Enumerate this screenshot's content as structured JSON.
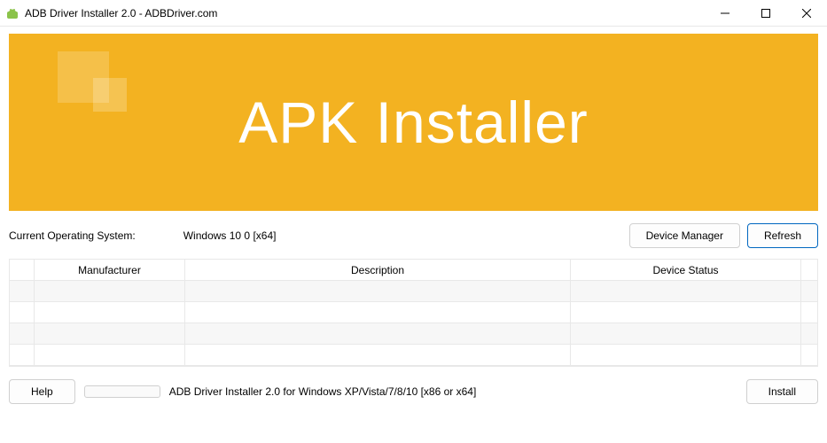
{
  "window": {
    "title": "ADB Driver Installer 2.0 - ADBDriver.com"
  },
  "banner": {
    "text": "APK Installer"
  },
  "os": {
    "label": "Current Operating System:",
    "value": "Windows 10 0 [x64]"
  },
  "buttons": {
    "device_manager": "Device Manager",
    "refresh": "Refresh",
    "help": "Help",
    "install": "Install"
  },
  "table": {
    "headers": {
      "manufacturer": "Manufacturer",
      "description": "Description",
      "device_status": "Device Status"
    }
  },
  "footer": {
    "status_text": "ADB Driver Installer 2.0 for Windows XP/Vista/7/8/10 [x86 or x64]"
  }
}
